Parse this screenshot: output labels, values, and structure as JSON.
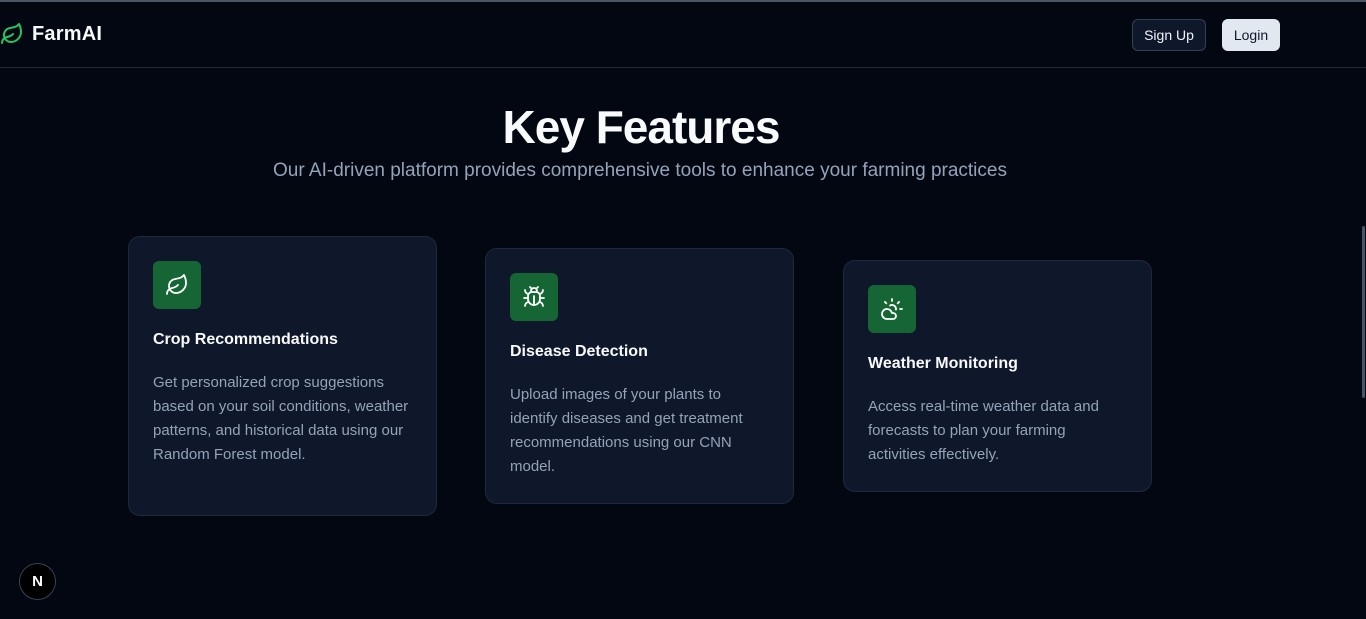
{
  "navbar": {
    "brand": "FarmAI",
    "signup_label": "Sign Up",
    "login_label": "Login"
  },
  "features": {
    "title": "Key Features",
    "subtitle": "Our AI-driven platform provides comprehensive tools to enhance your farming practices",
    "cards": [
      {
        "icon": "leaf-icon",
        "title": "Crop Recommendations",
        "description": "Get personalized crop suggestions based on your soil conditions, weather patterns, and historical data using our Random Forest model."
      },
      {
        "icon": "bug-icon",
        "title": "Disease Detection",
        "description": "Upload images of your plants to identify diseases and get treatment recommendations using our CNN model."
      },
      {
        "icon": "cloud-sun-icon",
        "title": "Weather Monitoring",
        "description": "Access real-time weather data and forecasts to plan your farming activities effectively."
      }
    ]
  },
  "dev_badge": {
    "label": "N"
  },
  "colors": {
    "background": "#030712",
    "card": "#0f172a",
    "accent": "#166534",
    "brand_icon": "#22c55e"
  }
}
